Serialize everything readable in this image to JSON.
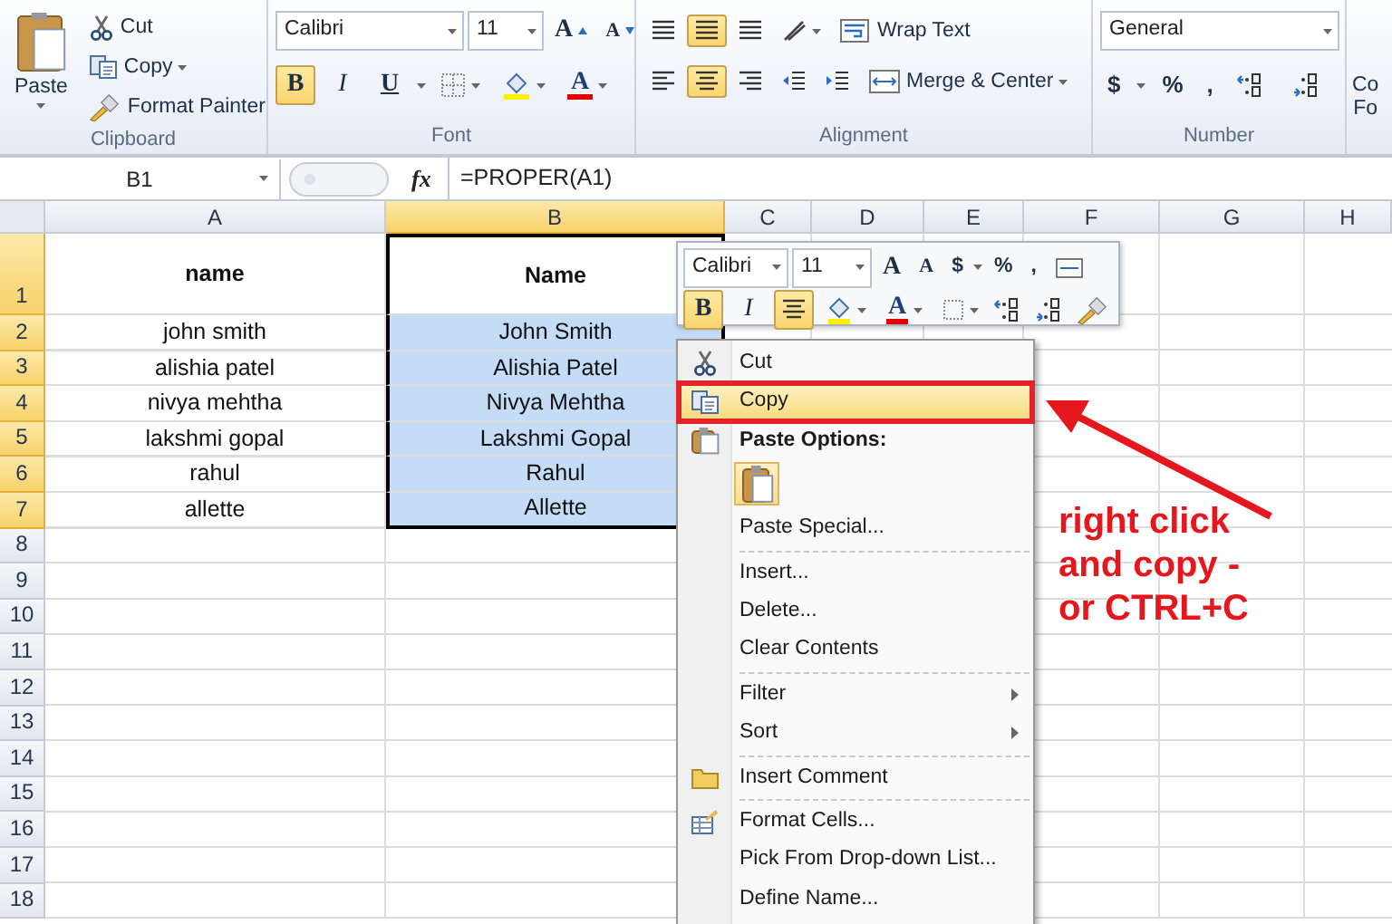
{
  "ribbon": {
    "groups": [
      {
        "kind": "clipboard",
        "label": "Clipboard",
        "paste": "Paste",
        "items": [
          {
            "label": "Cut",
            "dropdown": false
          },
          {
            "label": "Copy",
            "dropdown": true
          },
          {
            "label": "Format Painter",
            "dropdown": false
          }
        ]
      },
      {
        "kind": "font",
        "label": "Font",
        "font_name": "Calibri",
        "font_size": "11",
        "grow": "A",
        "shrink": "A",
        "buttons": [
          {
            "label": "B",
            "selected": true
          },
          {
            "label": "I",
            "selected": false
          },
          {
            "label": "U",
            "selected": false
          }
        ],
        "font_color": "A"
      },
      {
        "kind": "alignment",
        "label": "Alignment",
        "vertical": [
          {
            "selected": false
          },
          {
            "selected": true
          },
          {
            "selected": false
          }
        ],
        "horizontal": [
          {
            "selected": false
          },
          {
            "selected": true
          },
          {
            "selected": false
          }
        ],
        "wrap_text": "Wrap Text",
        "merge": "Merge & Center"
      },
      {
        "kind": "number",
        "label": "Number",
        "format": "General",
        "symbols": [
          "$",
          "%",
          ","
        ]
      },
      {
        "kind": "partial",
        "lines": [
          "Co",
          "Fo"
        ]
      }
    ]
  },
  "formula_bar": {
    "name_box": "B1",
    "fx": "fx",
    "formula": "=PROPER(A1)"
  },
  "sheet": {
    "columns": [
      {
        "label": "A",
        "selected": false
      },
      {
        "label": "B",
        "selected": true
      },
      {
        "label": "C",
        "selected": false
      },
      {
        "label": "D",
        "selected": false
      },
      {
        "label": "E",
        "selected": false
      },
      {
        "label": "F",
        "selected": false
      },
      {
        "label": "G",
        "selected": false
      },
      {
        "label": "H",
        "selected": false
      }
    ],
    "rows": [
      {
        "number": "1",
        "selected": true,
        "cells": [
          {
            "text": "name",
            "bold": true
          },
          {
            "text": "Name",
            "bold": true,
            "selected": false
          }
        ]
      },
      {
        "number": "2",
        "selected": true,
        "cells": [
          {
            "text": "john smith"
          },
          {
            "text": "John Smith",
            "selected": true
          }
        ]
      },
      {
        "number": "3",
        "selected": true,
        "cells": [
          {
            "text": "alishia patel"
          },
          {
            "text": "Alishia Patel",
            "selected": true
          }
        ]
      },
      {
        "number": "4",
        "selected": true,
        "cells": [
          {
            "text": "nivya mehtha"
          },
          {
            "text": "Nivya Mehtha",
            "selected": true
          }
        ]
      },
      {
        "number": "5",
        "selected": true,
        "cells": [
          {
            "text": "lakshmi gopal"
          },
          {
            "text": "Lakshmi Gopal",
            "selected": true
          }
        ]
      },
      {
        "number": "6",
        "selected": true,
        "cells": [
          {
            "text": "rahul"
          },
          {
            "text": "Rahul",
            "selected": true
          }
        ]
      },
      {
        "number": "7",
        "selected": true,
        "cells": [
          {
            "text": "allette"
          },
          {
            "text": "Allette",
            "selected": true
          }
        ]
      },
      {
        "number": "8",
        "selected": false
      },
      {
        "number": "9",
        "selected": false
      },
      {
        "number": "10",
        "selected": false
      },
      {
        "number": "11",
        "selected": false
      },
      {
        "number": "12",
        "selected": false
      },
      {
        "number": "13",
        "selected": false
      },
      {
        "number": "14",
        "selected": false
      },
      {
        "number": "15",
        "selected": false
      },
      {
        "number": "16",
        "selected": false
      },
      {
        "number": "17",
        "selected": false
      },
      {
        "number": "18",
        "selected": false
      }
    ]
  },
  "mini_toolbar": {
    "font_name": "Calibri",
    "font_size": "11",
    "grow": "A",
    "shrink": "A",
    "symbols": [
      "$",
      "%",
      ","
    ],
    "buttons": [
      {
        "label": "B",
        "selected": true
      },
      {
        "label": "I",
        "selected": false
      }
    ],
    "center_selected": true,
    "font_color": "A"
  },
  "context_menu": {
    "items": [
      {
        "kind": "item",
        "label": "Cut",
        "selected": false,
        "has_icon": true
      },
      {
        "kind": "item",
        "label": "Copy",
        "selected": true,
        "has_icon": true
      },
      {
        "kind": "header",
        "label": "Paste Options:",
        "has_icon": true
      },
      {
        "kind": "paste_button"
      },
      {
        "kind": "item",
        "label": "Paste Special...",
        "selected": false
      },
      {
        "kind": "separator"
      },
      {
        "kind": "item",
        "label": "Insert...",
        "selected": false
      },
      {
        "kind": "item",
        "label": "Delete...",
        "selected": false
      },
      {
        "kind": "item",
        "label": "Clear Contents",
        "selected": false
      },
      {
        "kind": "separator"
      },
      {
        "kind": "item",
        "label": "Filter",
        "selected": false,
        "submenu": true
      },
      {
        "kind": "item",
        "label": "Sort",
        "selected": false,
        "submenu": true
      },
      {
        "kind": "separator"
      },
      {
        "kind": "item",
        "label": "Insert Comment",
        "selected": false,
        "has_icon": true
      },
      {
        "kind": "separator"
      },
      {
        "kind": "item",
        "label": "Format Cells...",
        "selected": false,
        "has_icon": true
      },
      {
        "kind": "item",
        "label": "Pick From Drop-down List...",
        "selected": false
      },
      {
        "kind": "item",
        "label": "Define Name...",
        "selected": false
      }
    ]
  },
  "annotation": {
    "text": "right click\nand copy -\nor CTRL+C"
  }
}
